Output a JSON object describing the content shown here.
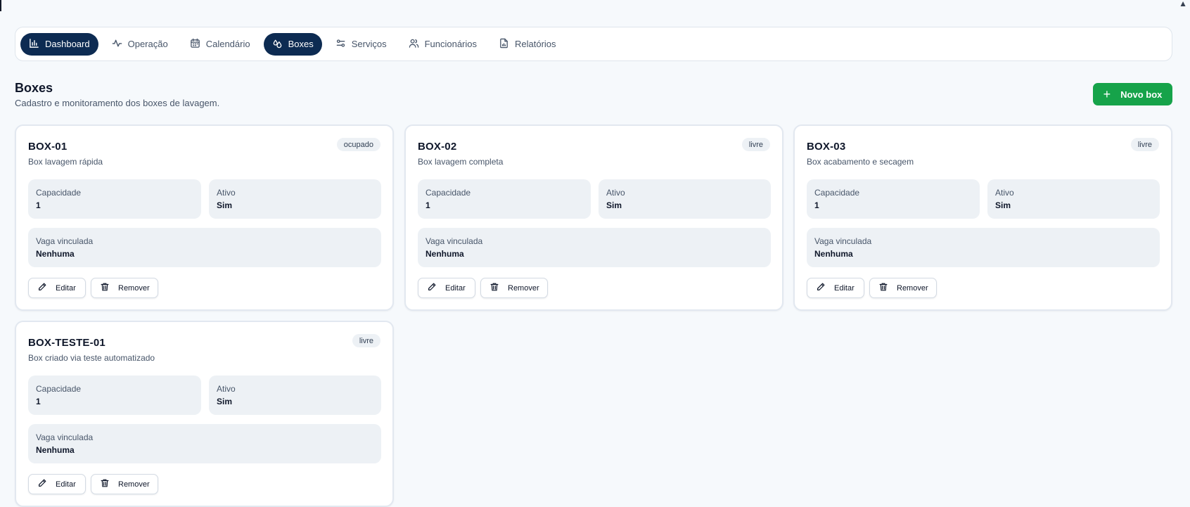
{
  "nav": {
    "items": [
      {
        "label": "Dashboard",
        "icon": "bar-chart-icon",
        "active": true
      },
      {
        "label": "Operação",
        "icon": "activity-icon",
        "active": false
      },
      {
        "label": "Calendário",
        "icon": "calendar-icon",
        "active": false
      },
      {
        "label": "Boxes",
        "icon": "droplets-icon",
        "active": true
      },
      {
        "label": "Serviços",
        "icon": "sliders-icon",
        "active": false
      },
      {
        "label": "Funcionários",
        "icon": "users-icon",
        "active": false
      },
      {
        "label": "Relatórios",
        "icon": "file-chart-icon",
        "active": false
      }
    ]
  },
  "page": {
    "title": "Boxes",
    "subtitle": "Cadastro e monitoramento dos boxes de lavagem.",
    "new_button": "Novo box"
  },
  "labels": {
    "capacidade": "Capacidade",
    "ativo": "Ativo",
    "vaga": "Vaga vinculada",
    "edit": "Editar",
    "remove": "Remover"
  },
  "boxes": [
    {
      "name": "BOX-01",
      "description": "Box lavagem rápida",
      "status": "ocupado",
      "capacidade": "1",
      "ativo": "Sim",
      "vaga": "Nenhuma"
    },
    {
      "name": "BOX-02",
      "description": "Box lavagem completa",
      "status": "livre",
      "capacidade": "1",
      "ativo": "Sim",
      "vaga": "Nenhuma"
    },
    {
      "name": "BOX-03",
      "description": "Box acabamento e secagem",
      "status": "livre",
      "capacidade": "1",
      "ativo": "Sim",
      "vaga": "Nenhuma"
    },
    {
      "name": "BOX-TESTE-01",
      "description": "Box criado via teste automatizado",
      "status": "livre",
      "capacidade": "1",
      "ativo": "Sim",
      "vaga": "Nenhuma"
    }
  ],
  "colors": {
    "nav_active": "#0d2b52",
    "primary_green": "#16a34a",
    "field_bg": "#edf1f5",
    "page_bg": "#f6f9fc"
  }
}
